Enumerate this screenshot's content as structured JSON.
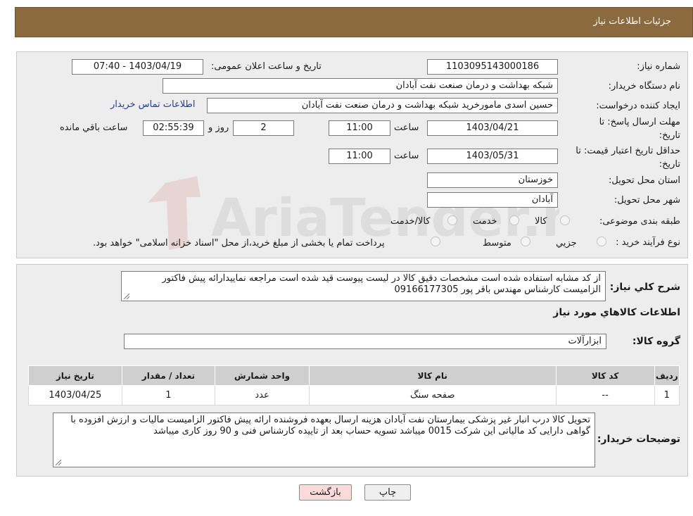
{
  "header": {
    "title": "جزئیات اطلاعات نیاز"
  },
  "labels": {
    "need_number": "شماره نیاز:",
    "announce_datetime": "تاریخ و ساعت اعلان عمومی:",
    "buyer_org": "نام دستگاه خریدار:",
    "requester": "ایجاد کننده درخواست:",
    "contact_link": "اطلاعات تماس خریدار",
    "deadline_line1": "مهلت ارسال پاسخ: تا",
    "deadline_line2": "تاریخ:",
    "time_word": "ساعت",
    "day_word": "روز و",
    "remaining": "ساعت باقي مانده",
    "validity_line1": "حداقل تاریخ اعتبار قیمت: تا",
    "validity_line2": "تاریخ:",
    "province": "استان محل تحویل:",
    "city": "شهر محل تحویل:",
    "category": "طبقه بندی موضوعی:",
    "process_type": "نوع فرآیند خرید :",
    "description": "شرح کلي نياز:",
    "goods_info": "اطلاعات کالاهاي مورد نياز",
    "goods_group": "گروه کالا:",
    "buyer_notes": "توضیحات خریدار:"
  },
  "values": {
    "need_number": "1103095143000186",
    "announce_datetime": "1403/04/19 - 07:40",
    "buyer_org": "شبکه بهداشت و درمان صنعت نفت آبادان",
    "requester": "حسین اسدی مامورخرید شبکه بهداشت و درمان صنعت نفت آبادان",
    "deadline_date": "1403/04/21",
    "deadline_time": "11:00",
    "deadline_days": "2",
    "deadline_remaining": "02:55:39",
    "validity_date": "1403/05/31",
    "validity_time": "11:00",
    "province": "خوزستان",
    "city": "آبادان",
    "description_text": "از کد مشابه استفاده شده است مشخصات دقیق کالا در لیست پیوست قید شده است مراجعه نمایيدارائه پیش فاکتور الزامیست کارشناس مهندس باقر پور 09166177305",
    "goods_group": "ابزارآلات",
    "buyer_notes_text": "تحویل کالا درب انبار غیر پزشکی بیمارستان نفت آبادان هزینه ارسال بعهده فروشنده ارائه پیش فاکتور الزامیست مالیات و ارزش افزوده با گواهی دارایی کد مالیاتی این شرکت 0015 میباشد  تسویه حساب بعد از تاییده کارشناس فنی و 90 روز کاری میباشد"
  },
  "category_options": [
    "کالا",
    "خدمت",
    "کالا/خدمت"
  ],
  "process_options": [
    "جزیي",
    "متوسط"
  ],
  "process_note": "پرداخت تمام یا بخشی از مبلغ خرید،از محل \"اسناد خزانه اسلامی\" خواهد بود.",
  "table": {
    "headers": [
      "ردیف",
      "کد کالا",
      "نام کالا",
      "واحد شمارش",
      "تعداد / مقدار",
      "تاریخ نیاز"
    ],
    "rows": [
      [
        "1",
        "--",
        "صفحه سنگ",
        "عدد",
        "1",
        "1403/04/25"
      ]
    ]
  },
  "buttons": {
    "back": "بازگشت",
    "print": "چاپ"
  },
  "watermark": {
    "brand_text": "AriaTender.neT"
  },
  "colors": {
    "header_bg": "#8a6a3e",
    "panel_bg": "#ededed",
    "link": "#1b3ea8",
    "back_button": "#fbdada"
  }
}
